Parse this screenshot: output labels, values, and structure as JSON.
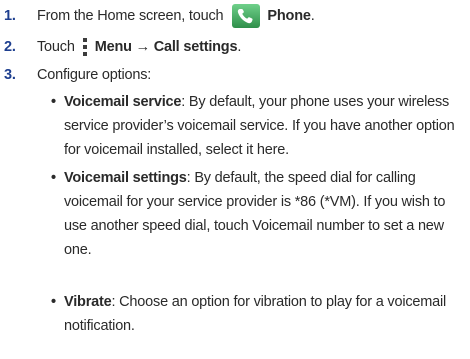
{
  "steps": [
    {
      "number": "1.",
      "pre": "From the Home screen, touch",
      "icon": "phone-icon",
      "bold": "Phone",
      "post": "."
    },
    {
      "number": "2.",
      "pre": "Touch",
      "icon": "menu-icon",
      "bold": "Menu → Call settings",
      "post": "."
    },
    {
      "number": "3.",
      "text": "Configure options:"
    }
  ],
  "options": [
    {
      "title": "Voicemail service",
      "desc": ": By default, your phone uses your wireless service provider’s voicemail service. If you have another option for voicemail installed, select it here."
    },
    {
      "title": "Voicemail settings",
      "desc": ": By default, the speed dial for calling voicemail for your service provider is *86 (*VM). If you wish to use another speed dial, touch Voicemail number to set a new one."
    },
    {
      "title": "Vibrate",
      "desc": ": Choose an option for vibration to play for a voicemail notification."
    }
  ],
  "colors": {
    "step_number": "#1e3f8f",
    "phone_icon_bg": "#3aa55b",
    "menu_icon": "#3c3c3c"
  }
}
